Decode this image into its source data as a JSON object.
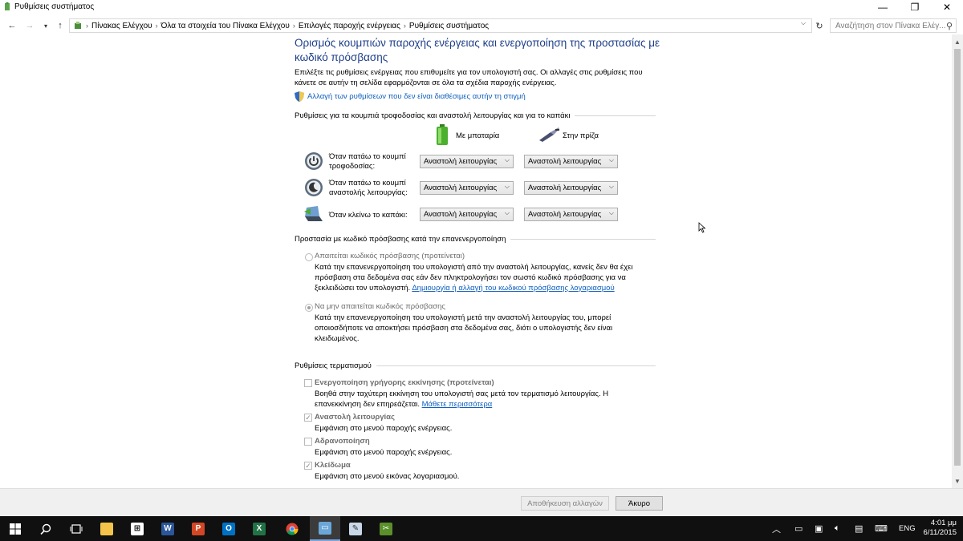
{
  "window": {
    "title": "Ρυθμίσεις συστήματος"
  },
  "address": {
    "crumbs": [
      "Πίνακας Ελέγχου",
      "Όλα τα στοιχεία του Πίνακα Ελέγχου",
      "Επιλογές παροχής ενέργειας",
      "Ρυθμίσεις συστήματος"
    ],
    "search_placeholder": "Αναζήτηση στον Πίνακα Ελέγ..."
  },
  "page": {
    "title": "Ορισμός κουμπιών παροχής ενέργειας και ενεργοποίηση της προστασίας με κωδικό πρόσβασης",
    "intro": "Επιλέξτε τις ρυθμίσεις ενέργειας που επιθυμείτε για τον υπολογιστή σας. Οι αλλαγές στις ρυθμίσεις που κάνετε σε αυτήν τη σελίδα εφαρμόζονται σε όλα τα σχέδια παροχής ενέργειας.",
    "change_unavailable_link": "Αλλαγή των ρυθμίσεων που δεν είναι διαθέσιμες αυτήν τη στιγμή"
  },
  "buttons_section": {
    "heading": "Ρυθμίσεις για τα κουμπιά τροφοδοσίας και αναστολή λειτουργίας και για το καπάκι",
    "col_battery": "Με μπαταρία",
    "col_plugged": "Στην πρίζα",
    "rows": [
      {
        "label": "Όταν πατάω το κουμπί τροφοδοσίας:",
        "battery": "Αναστολή λειτουργίας",
        "plugged": "Αναστολή λειτουργίας"
      },
      {
        "label": "Όταν πατάω το κουμπί αναστολής λειτουργίας:",
        "battery": "Αναστολή λειτουργίας",
        "plugged": "Αναστολή λειτουργίας"
      },
      {
        "label": "Όταν κλείνω το καπάκι:",
        "battery": "Αναστολή λειτουργίας",
        "plugged": "Αναστολή λειτουργίας"
      }
    ]
  },
  "password_section": {
    "heading": "Προστασία με κωδικό πρόσβασης κατά την επανενεργοποίηση",
    "require_label": "Απαιτείται κωδικός πρόσβασης (προτείνεται)",
    "require_desc": "Κατά την επανενεργοποίηση του υπολογιστή από την αναστολή λειτουργίας, κανείς δεν θα έχει πρόσβαση στα δεδομένα σας εάν δεν πληκτρολογήσει τον σωστό κωδικό πρόσβασης για να ξεκλειδώσει τον υπολογιστή.",
    "require_link": "Δημιουργία ή αλλαγή του κωδικού πρόσβασης λογαριασμού",
    "norequire_label": "Να μην απαιτείται κωδικός πρόσβασης",
    "norequire_desc": "Κατά την επανενεργοποίηση του υπολογιστή μετά την αναστολή λειτουργίας του, μπορεί οποιοσδήποτε να αποκτήσει πρόσβαση στα δεδομένα σας, διότι ο υπολογιστής δεν είναι κλειδωμένος."
  },
  "shutdown_section": {
    "heading": "Ρυθμίσεις τερματισμού",
    "fast_label": "Ενεργοποίηση γρήγορης εκκίνησης (προτείνεται)",
    "fast_desc": "Βοηθά στην ταχύτερη εκκίνηση του υπολογιστή σας μετά τον τερματισμό λειτουργίας. Η επανεκκίνηση δεν επηρεάζεται.",
    "fast_link": "Μάθετε περισσότερα",
    "sleep_label": "Αναστολή λειτουργίας",
    "sleep_desc": "Εμφάνιση στο μενού παροχής ενέργειας.",
    "hibernate_label": "Αδρανοποίηση",
    "hibernate_desc": "Εμφάνιση στο μενού παροχής ενέργειας.",
    "lock_label": "Κλείδωμα",
    "lock_desc": "Εμφάνιση στο μενού εικόνας λογαριασμού."
  },
  "footer": {
    "save": "Αποθήκευση αλλαγών",
    "cancel": "Άκυρο"
  },
  "taskbar": {
    "language": "ENG",
    "time": "4:01 μμ",
    "date": "6/11/2015"
  }
}
